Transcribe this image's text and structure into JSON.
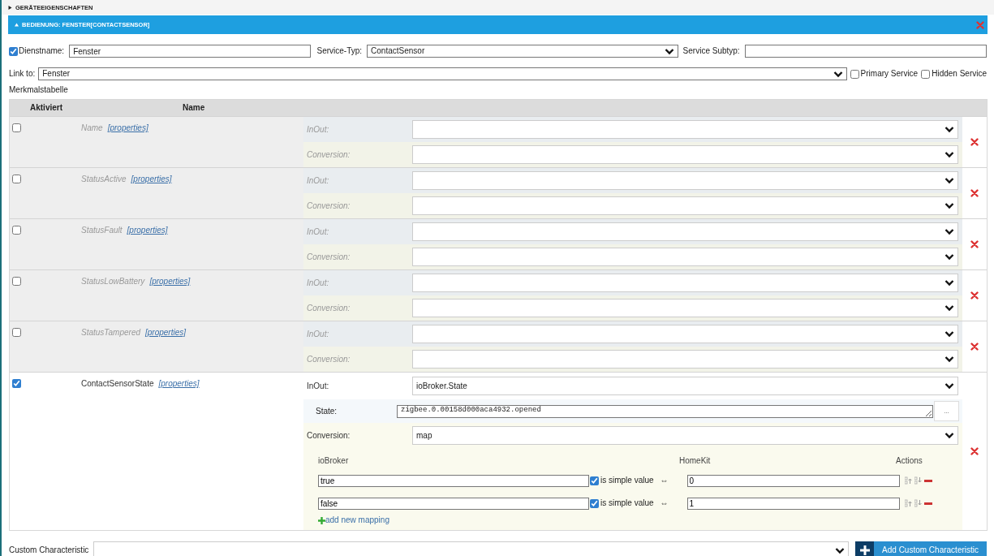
{
  "sections": [
    {
      "title": "GERÄTEEIGENSCHAFTEN",
      "expanded": false
    },
    {
      "title": "BEDIENUNG: FENSTER[CONTACTSENSOR]",
      "expanded": true
    }
  ],
  "service": {
    "enabled": true,
    "name_label": "Dienstname:",
    "name": "Fenster",
    "type_label": "Service-Typ:",
    "type": "ContactSensor",
    "subtype_label": "Service Subtyp:"
  },
  "link": {
    "label": "Link to:",
    "value": "Fenster"
  },
  "options": [
    {
      "label": "Primary Service",
      "checked": false
    },
    {
      "label": "Hidden Service",
      "checked": false
    }
  ],
  "table": {
    "title": "Merkmalstabelle",
    "columns": [
      "Aktiviert",
      "Name"
    ],
    "rows": [
      {
        "enabled": false,
        "name": "Name",
        "link": "[properties]",
        "inout_label": "InOut:",
        "conversion_label": "Conversion:"
      },
      {
        "enabled": false,
        "name": "StatusActive",
        "link": "[properties]",
        "inout_label": "InOut:",
        "conversion_label": "Conversion:"
      },
      {
        "enabled": false,
        "name": "StatusFault",
        "link": "[properties]",
        "inout_label": "InOut:",
        "conversion_label": "Conversion:"
      },
      {
        "enabled": false,
        "name": "StatusLowBattery",
        "link": "[properties]",
        "inout_label": "InOut:",
        "conversion_label": "Conversion:"
      },
      {
        "enabled": false,
        "name": "StatusTampered",
        "link": "[properties]",
        "inout_label": "InOut:",
        "conversion_label": "Conversion:"
      },
      {
        "enabled": true,
        "name": "ContactSensorState",
        "link": "[properties]",
        "inout_label": "InOut:",
        "inout": "ioBroker.State",
        "state_label": "State:",
        "state": "zigbee.0.00158d000aca4932.opened",
        "browse": "...",
        "conversion_label": "Conversion:",
        "conversion": "map",
        "mapping": {
          "columns": [
            "ioBroker",
            "HomeKit",
            "Actions"
          ],
          "entries": [
            {
              "iobroker": "true",
              "simple": true,
              "simple_label": "is simple value",
              "arrow": "⇔",
              "homekit": "0"
            },
            {
              "iobroker": "false",
              "simple": true,
              "simple_label": "is simple value",
              "arrow": "⇔",
              "homekit": "1"
            }
          ],
          "add": "add new mapping"
        }
      }
    ]
  },
  "custom": {
    "label": "Custom Characteristic",
    "button": "Add Custom Characteristic"
  }
}
